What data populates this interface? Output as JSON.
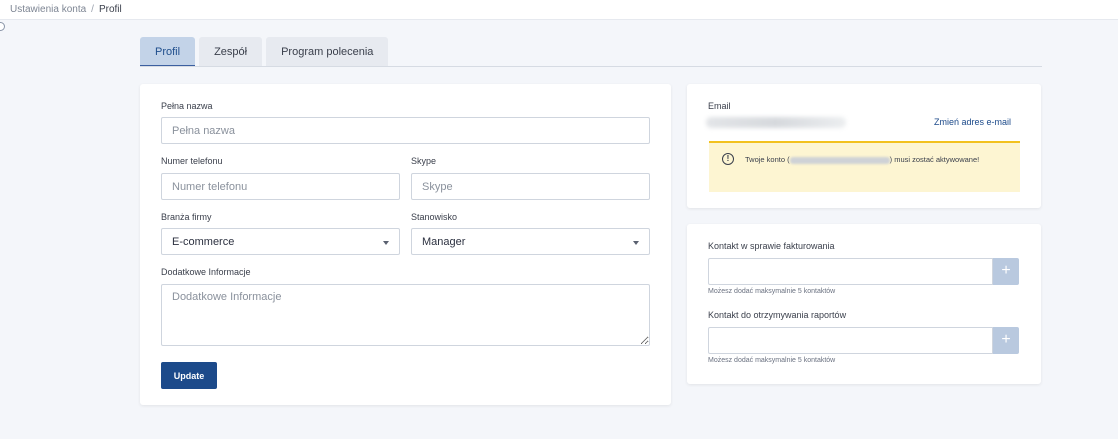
{
  "breadcrumb": {
    "parent": "Ustawienia konta",
    "separator": "/",
    "current": "Profil"
  },
  "tabs": [
    {
      "label": "Profil",
      "active": true
    },
    {
      "label": "Zespół",
      "active": false
    },
    {
      "label": "Program polecenia",
      "active": false
    }
  ],
  "form": {
    "full_name": {
      "label": "Pełna nazwa",
      "placeholder": "Pełna nazwa",
      "value": ""
    },
    "phone": {
      "label": "Numer telefonu",
      "placeholder": "Numer telefonu",
      "value": ""
    },
    "skype": {
      "label": "Skype",
      "placeholder": "Skype",
      "value": ""
    },
    "industry": {
      "label": "Branża firmy",
      "value": "E-commerce"
    },
    "position": {
      "label": "Stanowisko",
      "value": "Manager"
    },
    "extra_info": {
      "label": "Dodatkowe Informacje",
      "placeholder": "Dodatkowe Informacje",
      "value": ""
    },
    "update_label": "Update"
  },
  "email": {
    "label": "Email",
    "change_link": "Zmień adres e-mail",
    "alert_prefix": "Twoje konto (",
    "alert_suffix": ") musi zostać aktywowane!",
    "alert_icon": "!"
  },
  "contacts": {
    "billing": {
      "label": "Kontakt w sprawie fakturowania",
      "hint": "Możesz dodać maksymalnie 5 kontaktów"
    },
    "reports": {
      "label": "Kontakt do otrzymywania raportów",
      "hint": "Możesz dodać maksymalnie 5 kontaktów"
    },
    "add_symbol": "+"
  },
  "colors": {
    "primary": "#1c4a8a",
    "tab_active_bg": "#c3d3e8",
    "alert_bg": "#fdf5d2",
    "alert_border": "#f2c11e",
    "add_button": "#b9c9df"
  }
}
